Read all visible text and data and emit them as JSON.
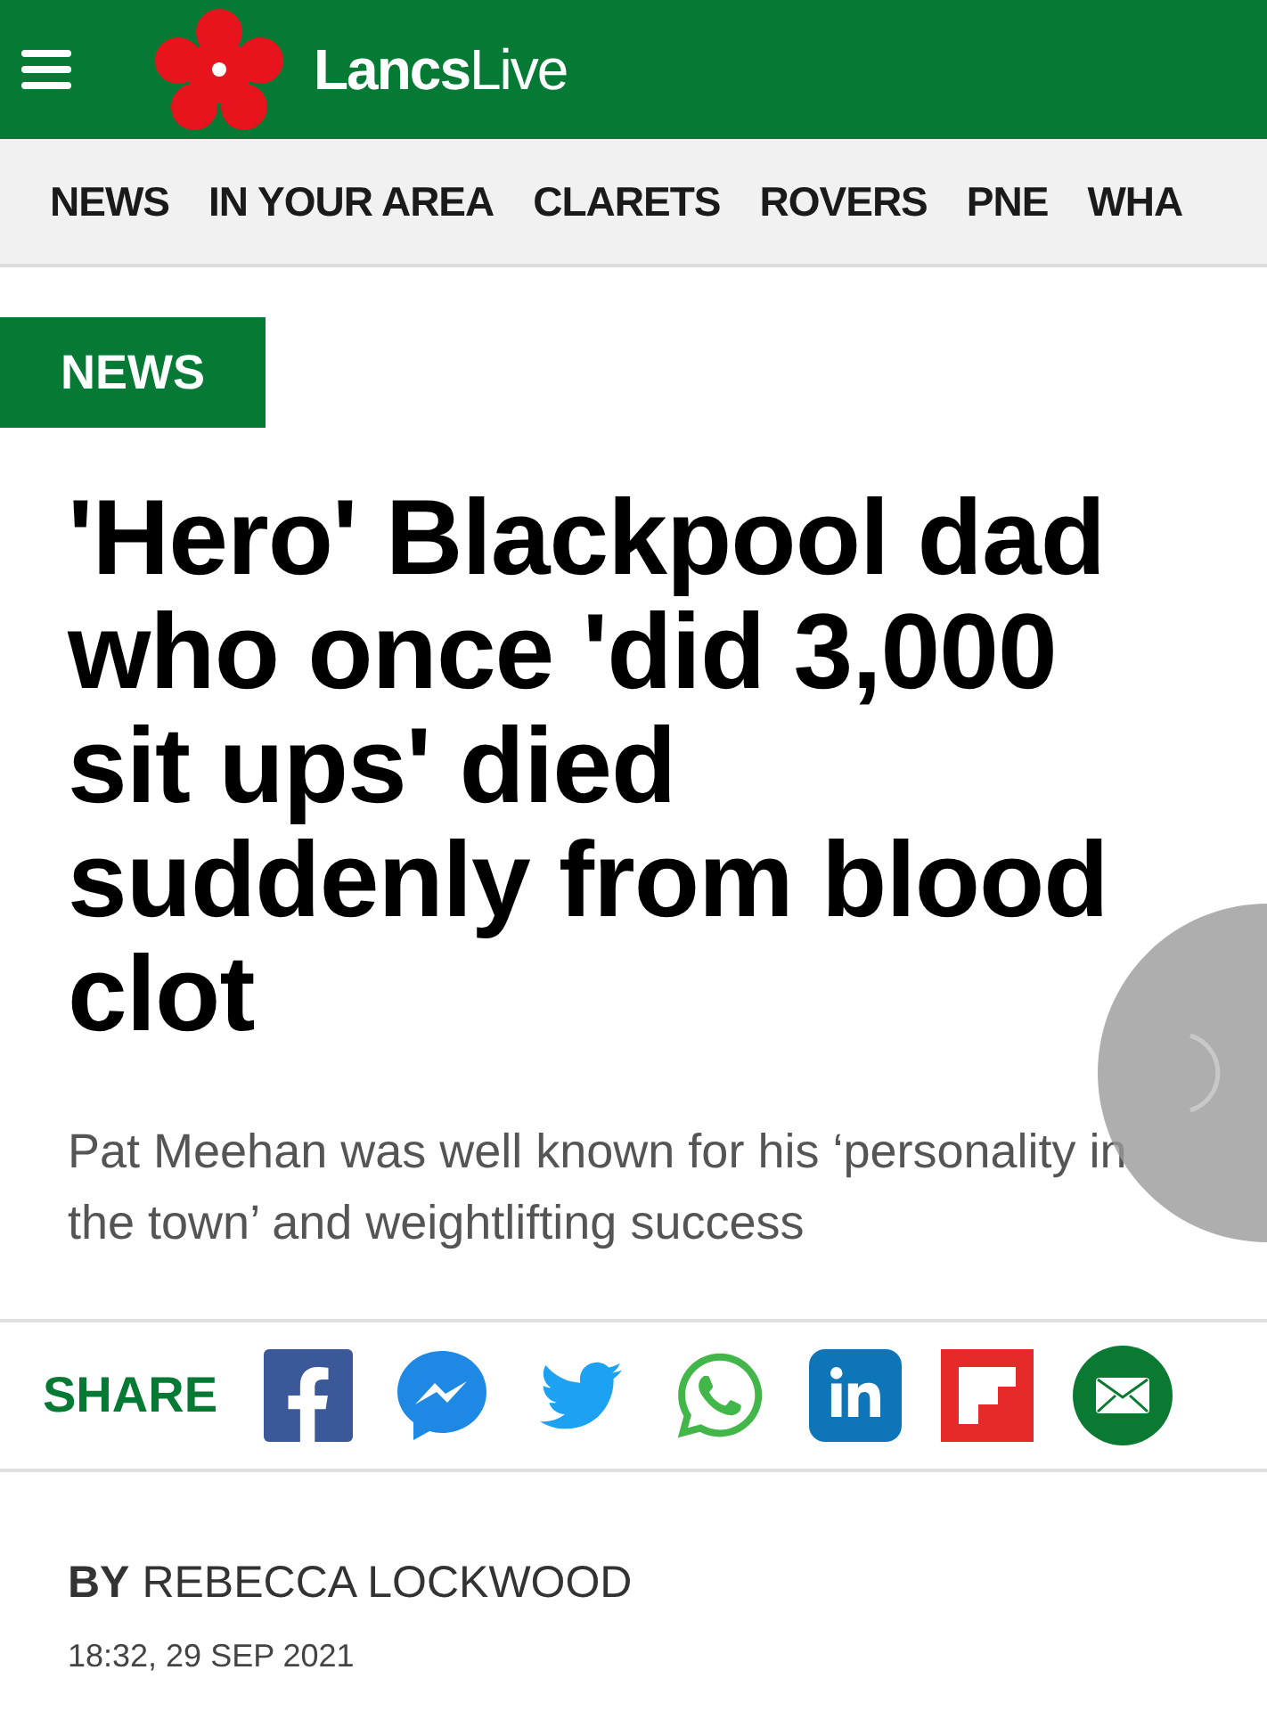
{
  "header": {
    "logo_bold": "Lancs",
    "logo_light": "Live"
  },
  "nav": {
    "items": [
      {
        "label": "NEWS"
      },
      {
        "label": "IN YOUR AREA"
      },
      {
        "label": "CLARETS"
      },
      {
        "label": "ROVERS"
      },
      {
        "label": "PNE"
      },
      {
        "label": "WHA"
      }
    ]
  },
  "article": {
    "section": "NEWS",
    "headline": "'Hero' Blackpool dad who once 'did 3,000 sit ups' died suddenly from blood clot",
    "standfirst": "Pat Meehan was well known for his ‘personality in the town’ and weightlifting success",
    "share": {
      "label": "SHARE",
      "buttons": [
        {
          "kind": "facebook"
        },
        {
          "kind": "messenger"
        },
        {
          "kind": "twitter"
        },
        {
          "kind": "whatsapp"
        },
        {
          "kind": "linkedin"
        },
        {
          "kind": "flipboard"
        },
        {
          "kind": "email"
        }
      ]
    },
    "byline": {
      "prefix": "BY",
      "author": "REBECCA LOCKWOOD",
      "date": "18:32, 29 SEP 2021"
    }
  }
}
